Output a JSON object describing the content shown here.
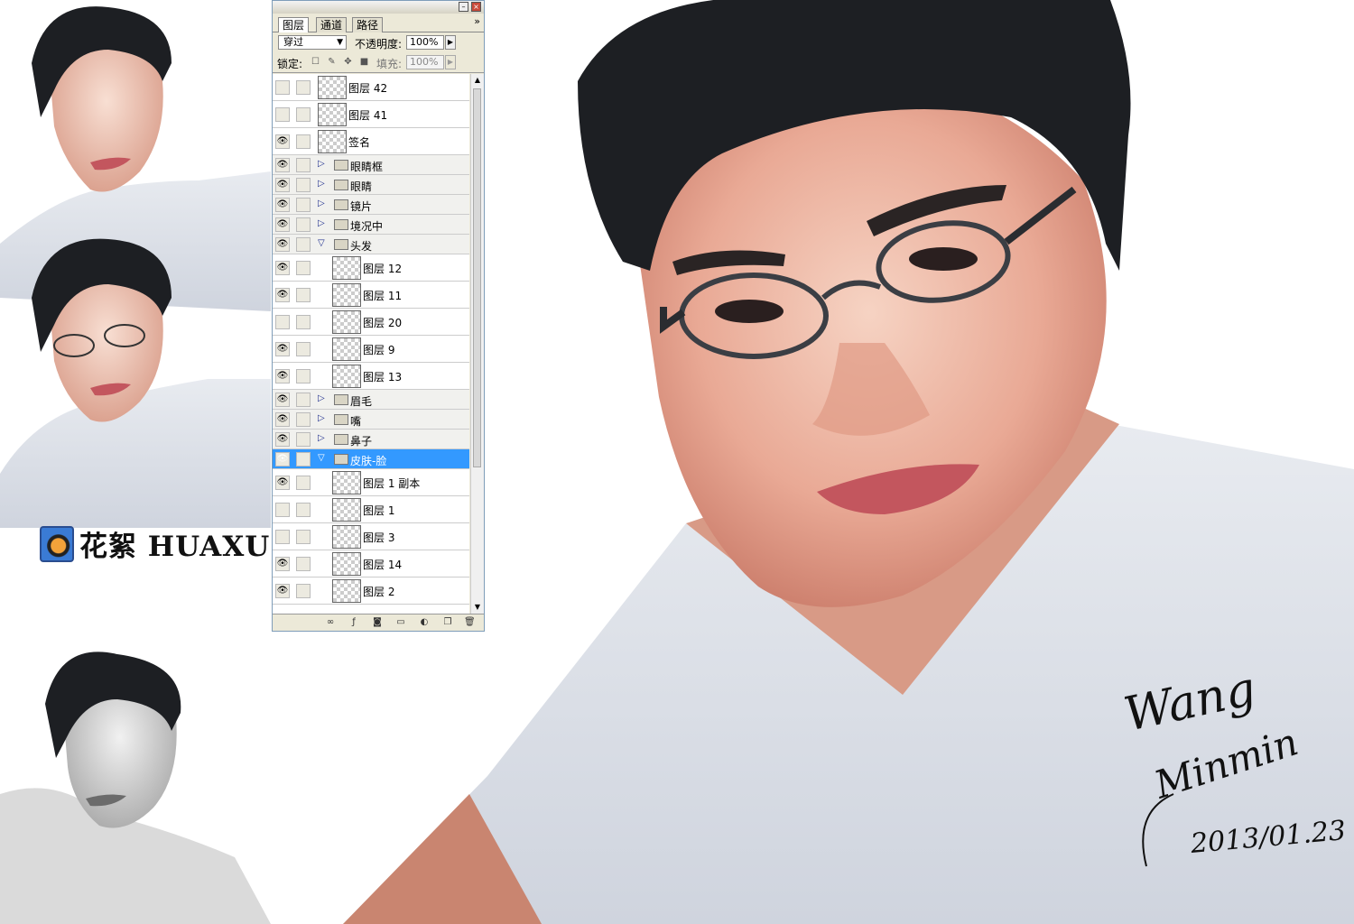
{
  "artwork": {
    "logo_text": "花絮 HUAXU",
    "signature": {
      "line1": "Wang",
      "line2": "Minmin",
      "date": "2013/01.23"
    }
  },
  "layers_panel": {
    "tabs": [
      {
        "label": "图层",
        "active": true
      },
      {
        "label": "通道",
        "active": false
      },
      {
        "label": "路径",
        "active": false
      }
    ],
    "blend_mode": "穿过",
    "opacity_label": "不透明度:",
    "opacity_value": "100%",
    "lock_label": "锁定:",
    "fill_label": "填充:",
    "fill_value": "100%",
    "layers": [
      {
        "name": "图层 42",
        "kind": "layer",
        "visible": false,
        "indent": 0
      },
      {
        "name": "图层 41",
        "kind": "layer",
        "visible": false,
        "indent": 0
      },
      {
        "name": "签名",
        "kind": "layer",
        "visible": true,
        "indent": 0
      },
      {
        "name": "眼睛框",
        "kind": "group",
        "visible": true,
        "expanded": false
      },
      {
        "name": "眼睛",
        "kind": "group",
        "visible": true,
        "expanded": false
      },
      {
        "name": "镜片",
        "kind": "group",
        "visible": true,
        "expanded": false
      },
      {
        "name": "境况中",
        "kind": "group",
        "visible": true,
        "expanded": false
      },
      {
        "name": "头发",
        "kind": "group",
        "visible": true,
        "expanded": true
      },
      {
        "name": "图层 12",
        "kind": "layer",
        "visible": true,
        "indent": 1
      },
      {
        "name": "图层 11",
        "kind": "layer",
        "visible": true,
        "indent": 1
      },
      {
        "name": "图层 20",
        "kind": "layer",
        "visible": false,
        "indent": 1
      },
      {
        "name": "图层 9",
        "kind": "layer",
        "visible": true,
        "indent": 1
      },
      {
        "name": "图层 13",
        "kind": "layer",
        "visible": true,
        "indent": 1
      },
      {
        "name": "眉毛",
        "kind": "group",
        "visible": true,
        "expanded": false
      },
      {
        "name": "嘴",
        "kind": "group",
        "visible": true,
        "expanded": false
      },
      {
        "name": "鼻子",
        "kind": "group",
        "visible": true,
        "expanded": false
      },
      {
        "name": "皮肤-脸",
        "kind": "group",
        "visible": true,
        "expanded": true,
        "selected": true
      },
      {
        "name": "图层 1 副本",
        "kind": "layer",
        "visible": true,
        "indent": 1
      },
      {
        "name": "图层 1",
        "kind": "layer",
        "visible": false,
        "indent": 1
      },
      {
        "name": "图层 3",
        "kind": "layer",
        "visible": false,
        "indent": 1
      },
      {
        "name": "图层 14",
        "kind": "layer",
        "visible": true,
        "indent": 1
      },
      {
        "name": "图层 2",
        "kind": "layer",
        "visible": true,
        "indent": 1
      }
    ]
  },
  "colors": {
    "selection": "#3399ff",
    "panel_bg": "#ece9d8",
    "shirt": "#dde1e9",
    "skin": "#e8a48f",
    "hair": "#1d1f23"
  }
}
